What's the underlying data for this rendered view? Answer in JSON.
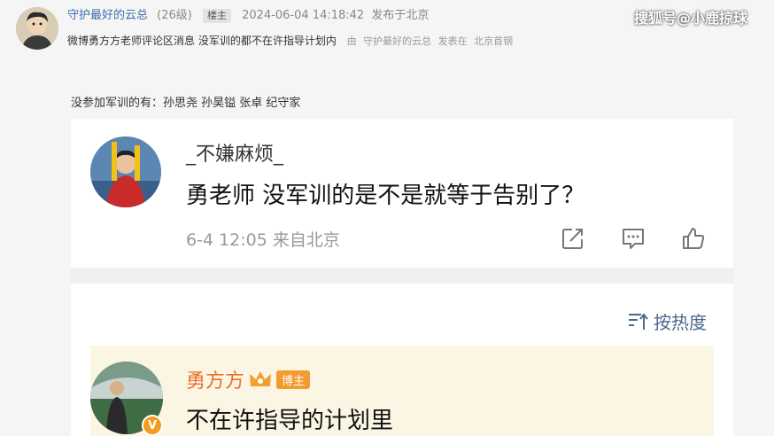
{
  "post": {
    "author": "守护最好的云总",
    "level": "(26级)",
    "badge": "楼主",
    "time": "2024-06-04 14:18:42",
    "location": "发布于北京",
    "title": "微博勇方方老师评论区消息 没军训的都不在许指导计划内",
    "meta_from": "由",
    "meta_author": "守护最好的云总",
    "meta_published": "发表在",
    "meta_board": "北京首钢",
    "text": "没参加军训的有：孙思尧 孙昊镒 张卓 纪守家"
  },
  "watermark": "搜狐号@小鹿掠球",
  "screenshot": {
    "comment": {
      "name": "_不嫌麻烦_",
      "text": "勇老师 没军训的是不是就等于告别了？",
      "time": "6-4 12:05",
      "location": "来自北京"
    },
    "sort_label": "按热度",
    "reply": {
      "name": "勇方方",
      "badge": "博主",
      "text": "不在许指导的计划里",
      "verified_mark": "V"
    }
  },
  "colors": {
    "author_link": "#3a6fb0",
    "sort_link": "#4a6a8c",
    "reply_name": "#e8702a",
    "owner_badge": "#f29b2f",
    "reply_bg": "#fbf6e4"
  },
  "icons": {
    "share": "share-icon",
    "comment": "comment-icon",
    "like": "thumbs-up-icon",
    "sort": "sort-icon",
    "crown": "crown-icon"
  }
}
